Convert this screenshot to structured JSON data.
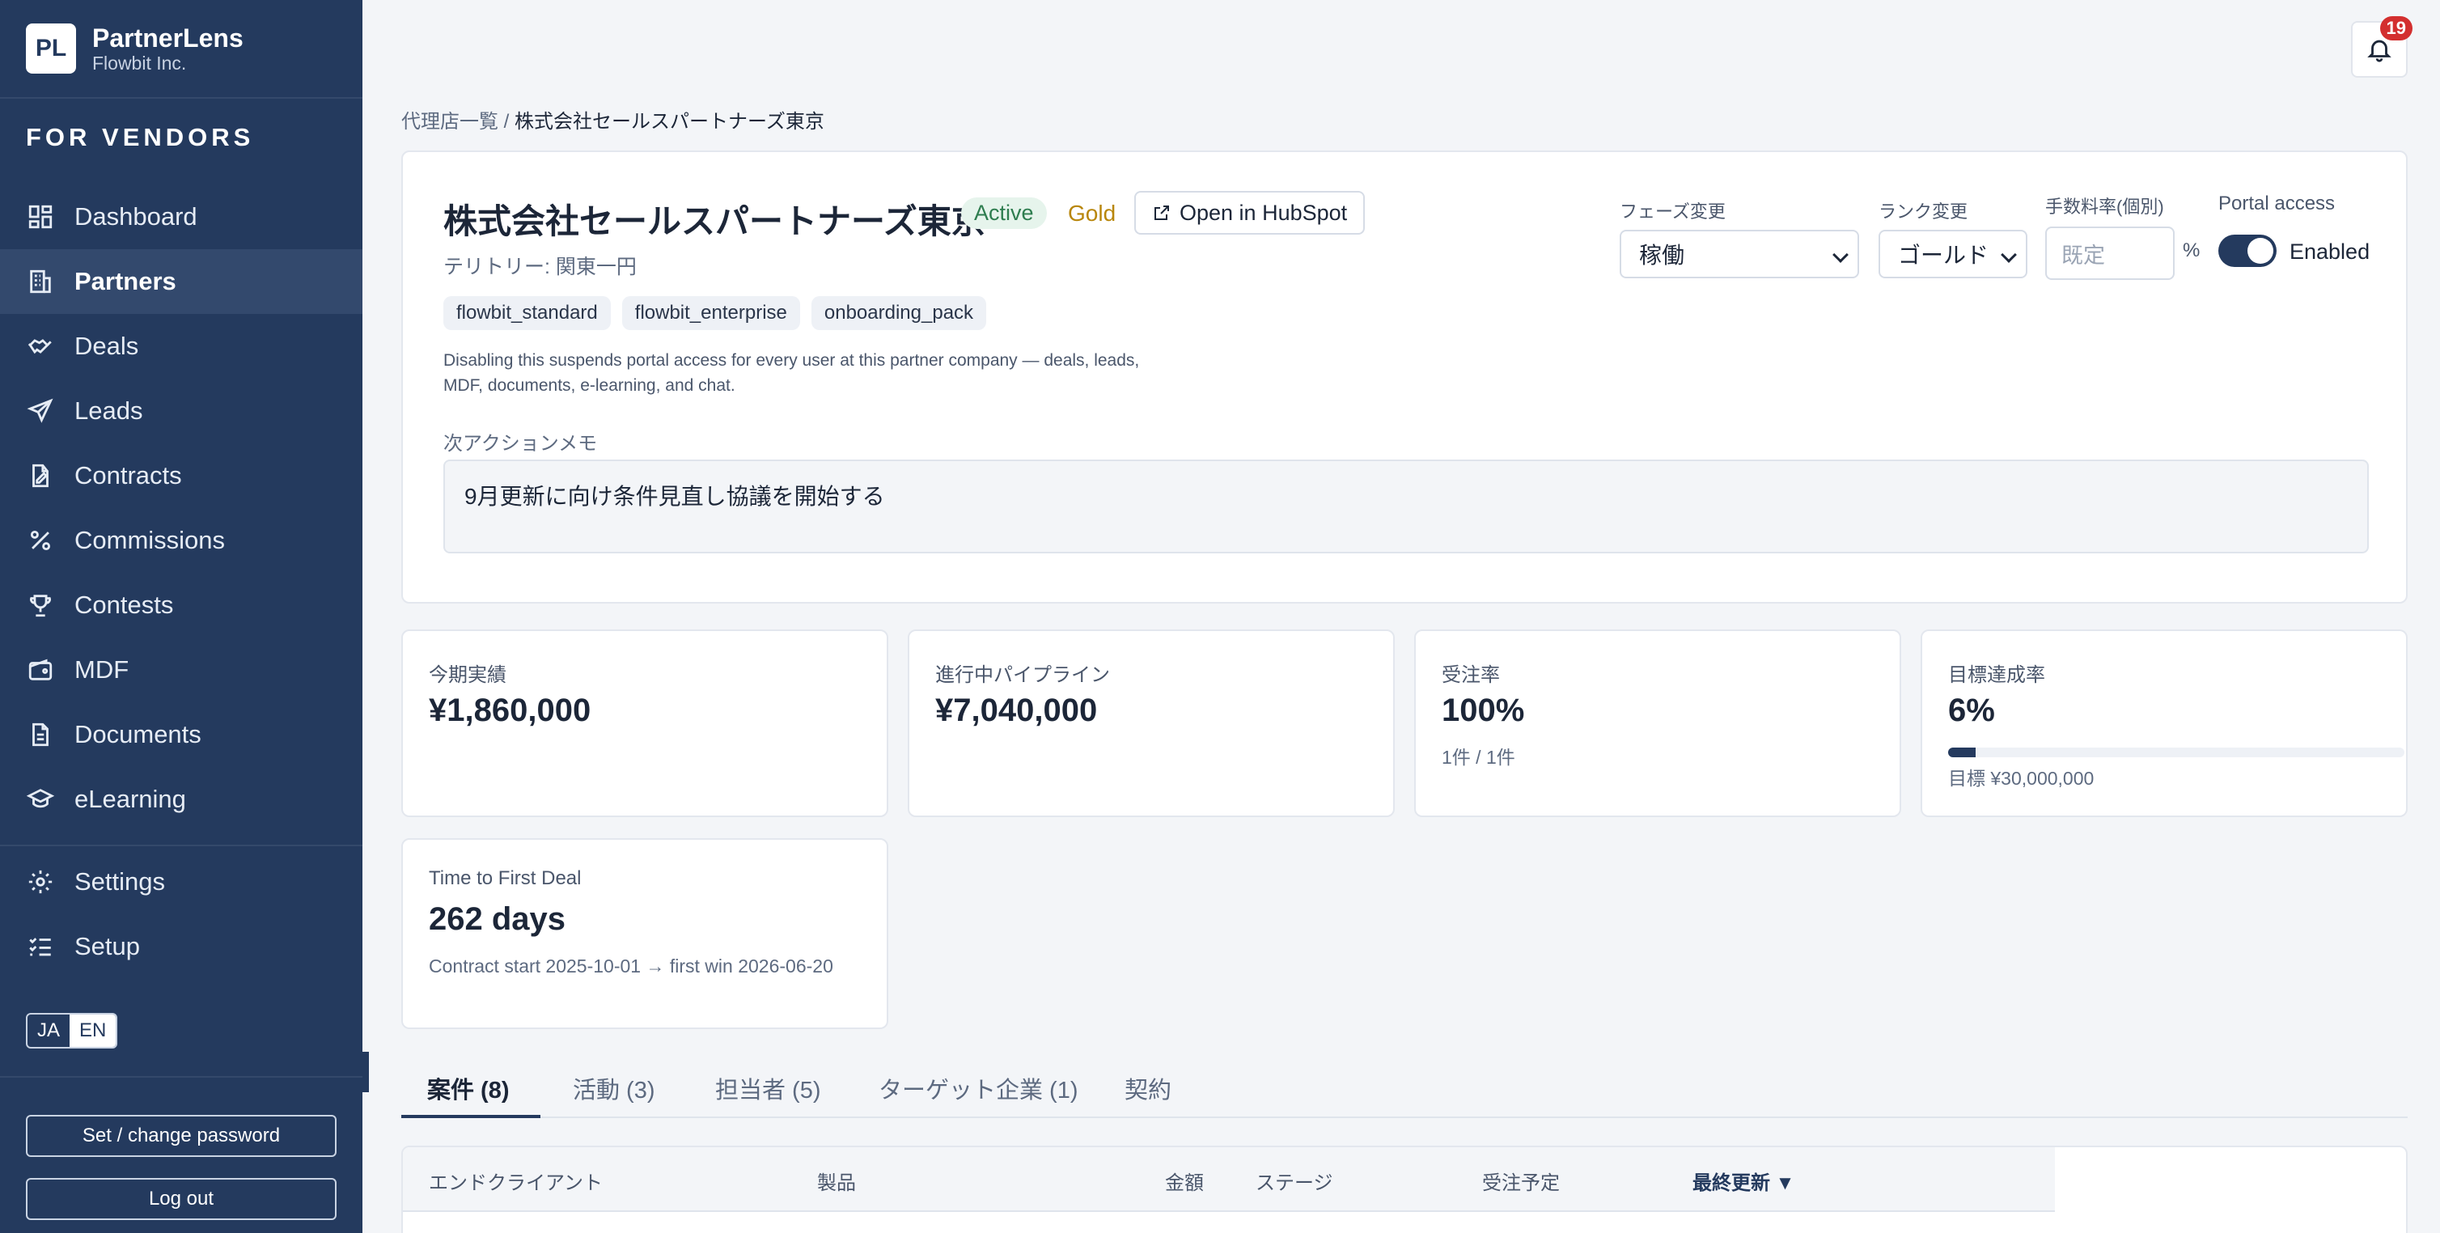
{
  "brand": {
    "logo": "PL",
    "name": "PartnerLens",
    "company": "Flowbit Inc."
  },
  "sidebar": {
    "section": "FOR VENDORS",
    "items": [
      {
        "label": "Dashboard",
        "icon": "dashboard-icon"
      },
      {
        "label": "Partners",
        "icon": "building-icon",
        "active": true
      },
      {
        "label": "Deals",
        "icon": "handshake-icon"
      },
      {
        "label": "Leads",
        "icon": "send-icon"
      },
      {
        "label": "Contracts",
        "icon": "contract-icon"
      },
      {
        "label": "Commissions",
        "icon": "percent-icon"
      },
      {
        "label": "Contests",
        "icon": "trophy-icon"
      },
      {
        "label": "MDF",
        "icon": "wallet-icon"
      },
      {
        "label": "Documents",
        "icon": "document-icon"
      },
      {
        "label": "eLearning",
        "icon": "graduation-cap-icon"
      }
    ],
    "bottom_items": [
      {
        "label": "Settings",
        "icon": "gear-icon"
      },
      {
        "label": "Setup",
        "icon": "checklist-icon"
      }
    ],
    "lang": {
      "ja": "JA",
      "en": "EN",
      "selected": "EN"
    },
    "password_button": "Set / change password",
    "logout_button": "Log out"
  },
  "header": {
    "notifications_count": "19"
  },
  "breadcrumb": {
    "parent": "代理店一覧",
    "separator": "/",
    "current": "株式会社セールスパートナーズ東京"
  },
  "partner": {
    "name": "株式会社セールスパートナーズ東京",
    "status": "Active",
    "rank": "Gold",
    "hubspot_button": "Open in HubSpot",
    "territory": "テリトリー: 関東一円",
    "tags": [
      "flowbit_standard",
      "flowbit_enterprise",
      "onboarding_pack"
    ],
    "disclaimer": "Disabling this suspends portal access for every user at this partner company — deals, leads, MDF, documents, e-learning, and chat.",
    "memo_label": "次アクションメモ",
    "memo": "9月更新に向け条件見直し協議を開始する"
  },
  "controls": {
    "phase_label": "フェーズ変更",
    "phase_value": "稼働",
    "rank_label": "ランク変更",
    "rank_value": "ゴールド",
    "rate_label": "手数料率(個別)",
    "rate_placeholder": "既定",
    "rate_unit": "%",
    "portal_label": "Portal access",
    "portal_state": "Enabled"
  },
  "kpis": [
    {
      "label": "今期実績",
      "value": "¥1,860,000"
    },
    {
      "label": "進行中パイプライン",
      "value": "¥7,040,000"
    },
    {
      "label": "受注率",
      "value": "100%",
      "sub": "1件 / 1件"
    },
    {
      "label": "目標達成率",
      "value": "6%",
      "progress_percent": 6,
      "sub": "目標 ¥30,000,000"
    },
    {
      "label": "Time to First Deal",
      "value": "262 days",
      "sub": "Contract start 2025-10-01 → first win 2026-06-20"
    }
  ],
  "tabs": [
    "案件 (8)",
    "活動 (3)",
    "担当者 (5)",
    "ターゲット企業 (1)",
    "契約"
  ],
  "table": {
    "columns": [
      "エンドクライアント",
      "製品",
      "金額",
      "ステージ",
      "受注予定",
      "最終更新 ▼"
    ]
  }
}
